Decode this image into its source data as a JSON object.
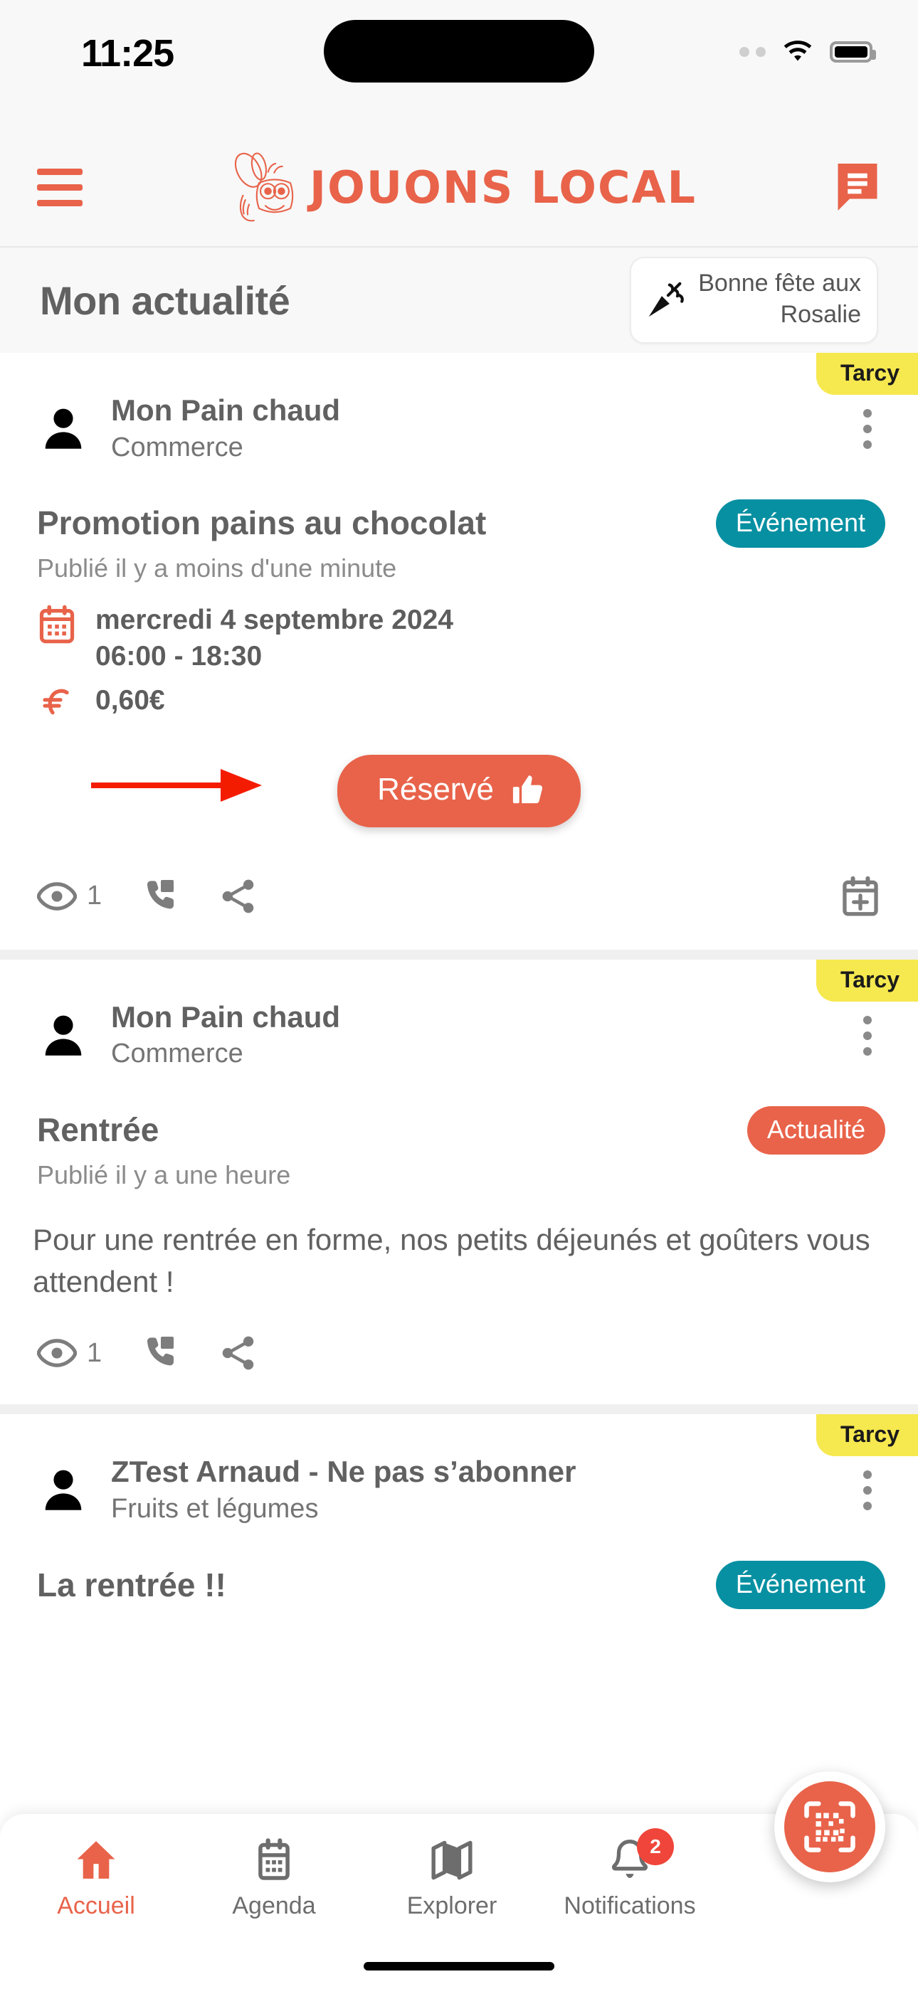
{
  "status_bar": {
    "time": "11:25",
    "wifi_icon": "wifi-icon",
    "battery_icon": "battery-icon",
    "signal_icon": "signal-dots-icon"
  },
  "app_header": {
    "menu_icon": "hamburger-menu-icon",
    "brand_name": "JOUONS LOCAL",
    "brand_logo_icon": "bee-logo-icon",
    "messages_icon": "chat-bubble-icon",
    "accent_color": "#e8634a"
  },
  "section": {
    "title": "Mon actualité",
    "nameday_card": {
      "icon": "party-popper-icon",
      "line1": "Bonne fête aux",
      "line2": "Rosalie"
    }
  },
  "posts": [
    {
      "tag": "Tarcy",
      "author": "Mon Pain chaud",
      "role": "Commerce",
      "avatar_icon": "person-avatar-icon",
      "menu_icon": "kebab-menu-icon",
      "title": "Promotion pains au chocolat",
      "badge": "Événement",
      "badge_color": "#0790a2",
      "published": "Publié il y a moins d'une minute",
      "date_icon": "calendar-icon",
      "date": "mercredi 4 septembre 2024",
      "time": "06:00 - 18:30",
      "price_icon": "euro-icon",
      "price": "0,60€",
      "cta_label": "Réservé",
      "cta_icon": "thumbs-up-icon",
      "annotation_arrow": "red-arrow-annotation",
      "views_icon": "eye-icon",
      "views": "1",
      "call_icon": "phone-icon",
      "share_icon": "share-icon",
      "calendar_add_icon": "calendar-plus-icon"
    },
    {
      "tag": "Tarcy",
      "author": "Mon Pain chaud",
      "role": "Commerce",
      "avatar_icon": "person-avatar-icon",
      "menu_icon": "kebab-menu-icon",
      "title": "Rentrée",
      "badge": "Actualité",
      "badge_color": "#e8634a",
      "published": "Publié il y a une heure",
      "body": "Pour une rentrée en forme, nos petits déjeunés et goûters vous attendent !",
      "views_icon": "eye-icon",
      "views": "1",
      "call_icon": "phone-icon",
      "share_icon": "share-icon"
    },
    {
      "tag": "Tarcy",
      "author": "ZTest Arnaud - Ne pas s’abonner",
      "role": "Fruits et légumes",
      "avatar_icon": "person-avatar-icon",
      "menu_icon": "kebab-menu-icon",
      "title": "La rentrée !!",
      "badge": "Événement",
      "badge_color": "#0790a2"
    }
  ],
  "bottom_nav": {
    "items": [
      {
        "label": "Accueil",
        "icon": "home-icon",
        "active": true
      },
      {
        "label": "Agenda",
        "icon": "calendar-icon",
        "active": false
      },
      {
        "label": "Explorer",
        "icon": "map-icon",
        "active": false
      },
      {
        "label": "Notifications",
        "icon": "bell-icon",
        "active": false,
        "badge": "2"
      }
    ],
    "fab_icon": "qr-code-scan-icon"
  }
}
